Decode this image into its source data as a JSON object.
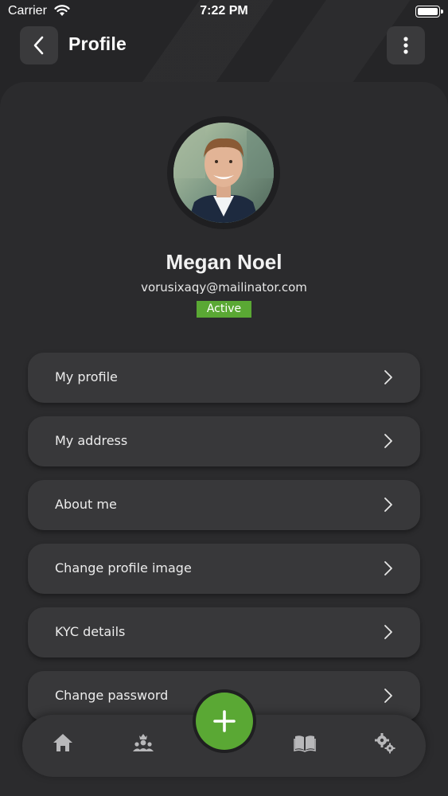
{
  "status_bar": {
    "carrier": "Carrier",
    "time": "7:22 PM"
  },
  "header": {
    "title": "Profile"
  },
  "profile": {
    "name": "Megan Noel",
    "email": "vorusixaqy@mailinator.com",
    "status": "Active"
  },
  "menu": {
    "items": [
      {
        "label": "My profile"
      },
      {
        "label": "My address"
      },
      {
        "label": "About me"
      },
      {
        "label": "Change profile image"
      },
      {
        "label": "KYC details"
      },
      {
        "label": "Change password"
      }
    ]
  },
  "bottom_nav": {
    "icons": [
      "home-icon",
      "team-icon",
      "add-icon",
      "book-icon",
      "settings-gears-icon"
    ]
  },
  "colors": {
    "accent": "#5aa834",
    "background": "#1f1f21",
    "card": "#2b2b2d",
    "item": "#38383a"
  }
}
